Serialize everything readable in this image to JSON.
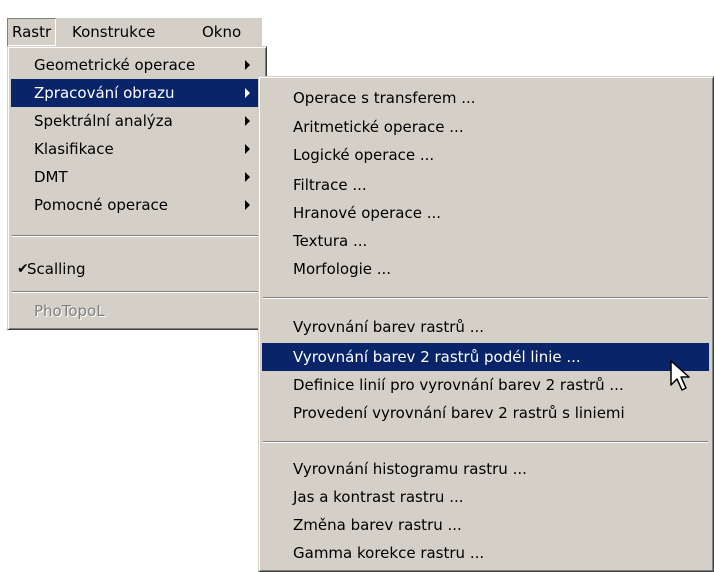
{
  "menubar": {
    "items": [
      "Rastr",
      "Konstrukce",
      "Okno"
    ]
  },
  "rastr_menu": {
    "items": [
      {
        "label": "Geometrické operace"
      },
      {
        "label": "Zpracování obrazu"
      },
      {
        "label": "Spektrální analýza"
      },
      {
        "label": "Klasifikace"
      },
      {
        "label": "DMT"
      },
      {
        "label": "Pomocné operace"
      },
      {
        "label": "Scalling"
      },
      {
        "label": "PhoTopoL"
      }
    ],
    "highlighted": "Zpracování obrazu",
    "checked": "Scalling",
    "disabled": "PhoTopoL"
  },
  "submenu": {
    "items": [
      {
        "label": "Operace s transferem ..."
      },
      {
        "label": "Aritmetické operace ..."
      },
      {
        "label": "Logické operace ..."
      },
      {
        "label": "Filtrace ..."
      },
      {
        "label": "Hranové operace ..."
      },
      {
        "label": "Textura ..."
      },
      {
        "label": "Morfologie ..."
      },
      {
        "label": "Vyrovnání barev rastrů ..."
      },
      {
        "label": "Vyrovnání barev 2 rastrů podél linie ..."
      },
      {
        "label": "Definice linií pro vyrovnání barev 2 rastrů ..."
      },
      {
        "label": "Provedení vyrovnání barev 2 rastrů s liniemi"
      },
      {
        "label": "Vyrovnání histogramu rastru ..."
      },
      {
        "label": "Jas a kontrast rastru ..."
      },
      {
        "label": "Změna barev rastru ..."
      },
      {
        "label": "Gamma korekce rastru ..."
      }
    ],
    "highlighted": "Vyrovnání barev 2 rastrů podél linie ..."
  },
  "colors": {
    "menu_bg": "#d4d0c8",
    "highlight": "#0a246a"
  },
  "icons": {
    "submenu_arrow": "triangle-right",
    "check": "checkmark",
    "cursor": "arrow-pointer"
  }
}
